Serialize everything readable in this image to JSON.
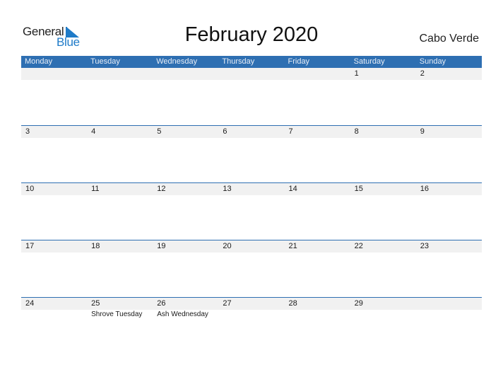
{
  "logo": {
    "line1": "General",
    "line2": "Blue"
  },
  "title": "February 2020",
  "country": "Cabo Verde",
  "colors": {
    "accent": "#2e6fb2",
    "logo_blue": "#1f7bc8",
    "strip": "#f1f1f1"
  },
  "weekdays": [
    "Monday",
    "Tuesday",
    "Wednesday",
    "Thursday",
    "Friday",
    "Saturday",
    "Sunday"
  ],
  "weeks": [
    {
      "days": [
        {
          "num": "",
          "holiday": ""
        },
        {
          "num": "",
          "holiday": ""
        },
        {
          "num": "",
          "holiday": ""
        },
        {
          "num": "",
          "holiday": ""
        },
        {
          "num": "",
          "holiday": ""
        },
        {
          "num": "1",
          "holiday": ""
        },
        {
          "num": "2",
          "holiday": ""
        }
      ]
    },
    {
      "days": [
        {
          "num": "3",
          "holiday": ""
        },
        {
          "num": "4",
          "holiday": ""
        },
        {
          "num": "5",
          "holiday": ""
        },
        {
          "num": "6",
          "holiday": ""
        },
        {
          "num": "7",
          "holiday": ""
        },
        {
          "num": "8",
          "holiday": ""
        },
        {
          "num": "9",
          "holiday": ""
        }
      ]
    },
    {
      "days": [
        {
          "num": "10",
          "holiday": ""
        },
        {
          "num": "11",
          "holiday": ""
        },
        {
          "num": "12",
          "holiday": ""
        },
        {
          "num": "13",
          "holiday": ""
        },
        {
          "num": "14",
          "holiday": ""
        },
        {
          "num": "15",
          "holiday": ""
        },
        {
          "num": "16",
          "holiday": ""
        }
      ]
    },
    {
      "days": [
        {
          "num": "17",
          "holiday": ""
        },
        {
          "num": "18",
          "holiday": ""
        },
        {
          "num": "19",
          "holiday": ""
        },
        {
          "num": "20",
          "holiday": ""
        },
        {
          "num": "21",
          "holiday": ""
        },
        {
          "num": "22",
          "holiday": ""
        },
        {
          "num": "23",
          "holiday": ""
        }
      ]
    },
    {
      "days": [
        {
          "num": "24",
          "holiday": ""
        },
        {
          "num": "25",
          "holiday": "Shrove Tuesday"
        },
        {
          "num": "26",
          "holiday": "Ash Wednesday"
        },
        {
          "num": "27",
          "holiday": ""
        },
        {
          "num": "28",
          "holiday": ""
        },
        {
          "num": "29",
          "holiday": ""
        },
        {
          "num": "",
          "holiday": ""
        }
      ]
    }
  ]
}
